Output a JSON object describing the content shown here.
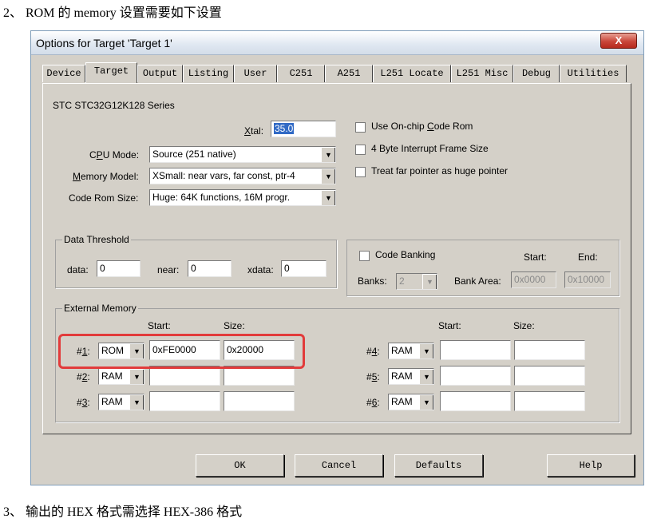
{
  "doc": {
    "line1": "2、 ROM 的 memory 设置需要如下设置",
    "line2": "3、 输出的 HEX 格式需选择 HEX-386 格式"
  },
  "dialog": {
    "title": "Options for Target 'Target 1'",
    "close_label": "X",
    "tabs": [
      "Device",
      "Target",
      "Output",
      "Listing",
      "User",
      "C251",
      "A251",
      "L251 Locate",
      "L251 Misc",
      "Debug",
      "Utilities"
    ],
    "active_tab": "Target",
    "device_name": "STC STC32G12K128 Series",
    "xtal": {
      "label": "Xtal:",
      "value": "35.0"
    },
    "cpu_mode": {
      "label": "CPU Mode:",
      "value": "Source (251 native)"
    },
    "memory_model": {
      "label": "Memory Model:",
      "value": "XSmall: near vars, far const, ptr-4"
    },
    "code_rom_size": {
      "label": "Code Rom Size:",
      "value": "Huge: 64K functions, 16M progr."
    },
    "options": [
      {
        "label": "Use On-chip Code Rom",
        "checked": false
      },
      {
        "label": "4 Byte Interrupt Frame Size",
        "checked": false
      },
      {
        "label": "Treat far pointer as huge pointer",
        "checked": false
      }
    ],
    "data_threshold": {
      "legend": "Data Threshold",
      "data_label": "data:",
      "data_value": "0",
      "near_label": "near:",
      "near_value": "0",
      "xdata_label": "xdata:",
      "xdata_value": "0"
    },
    "code_banking": {
      "label": "Code Banking",
      "checked": false,
      "start_label": "Start:",
      "end_label": "End:",
      "banks_label": "Banks:",
      "banks_value": "2",
      "bank_area_label": "Bank Area:",
      "bank_start": "0x0000",
      "bank_end": "0x10000"
    },
    "external_memory": {
      "legend": "External Memory",
      "start_label": "Start:",
      "size_label": "Size:",
      "rows": [
        {
          "num": "#1:",
          "type": "ROM",
          "start": "0xFE0000",
          "size": "0x20000"
        },
        {
          "num": "#2:",
          "type": "RAM",
          "start": "",
          "size": ""
        },
        {
          "num": "#3:",
          "type": "RAM",
          "start": "",
          "size": ""
        },
        {
          "num": "#4:",
          "type": "RAM",
          "start": "",
          "size": ""
        },
        {
          "num": "#5:",
          "type": "RAM",
          "start": "",
          "size": ""
        },
        {
          "num": "#6:",
          "type": "RAM",
          "start": "",
          "size": ""
        }
      ]
    },
    "buttons": {
      "ok": "OK",
      "cancel": "Cancel",
      "defaults": "Defaults",
      "help": "Help"
    },
    "highlight_color": "#e23b3b"
  }
}
